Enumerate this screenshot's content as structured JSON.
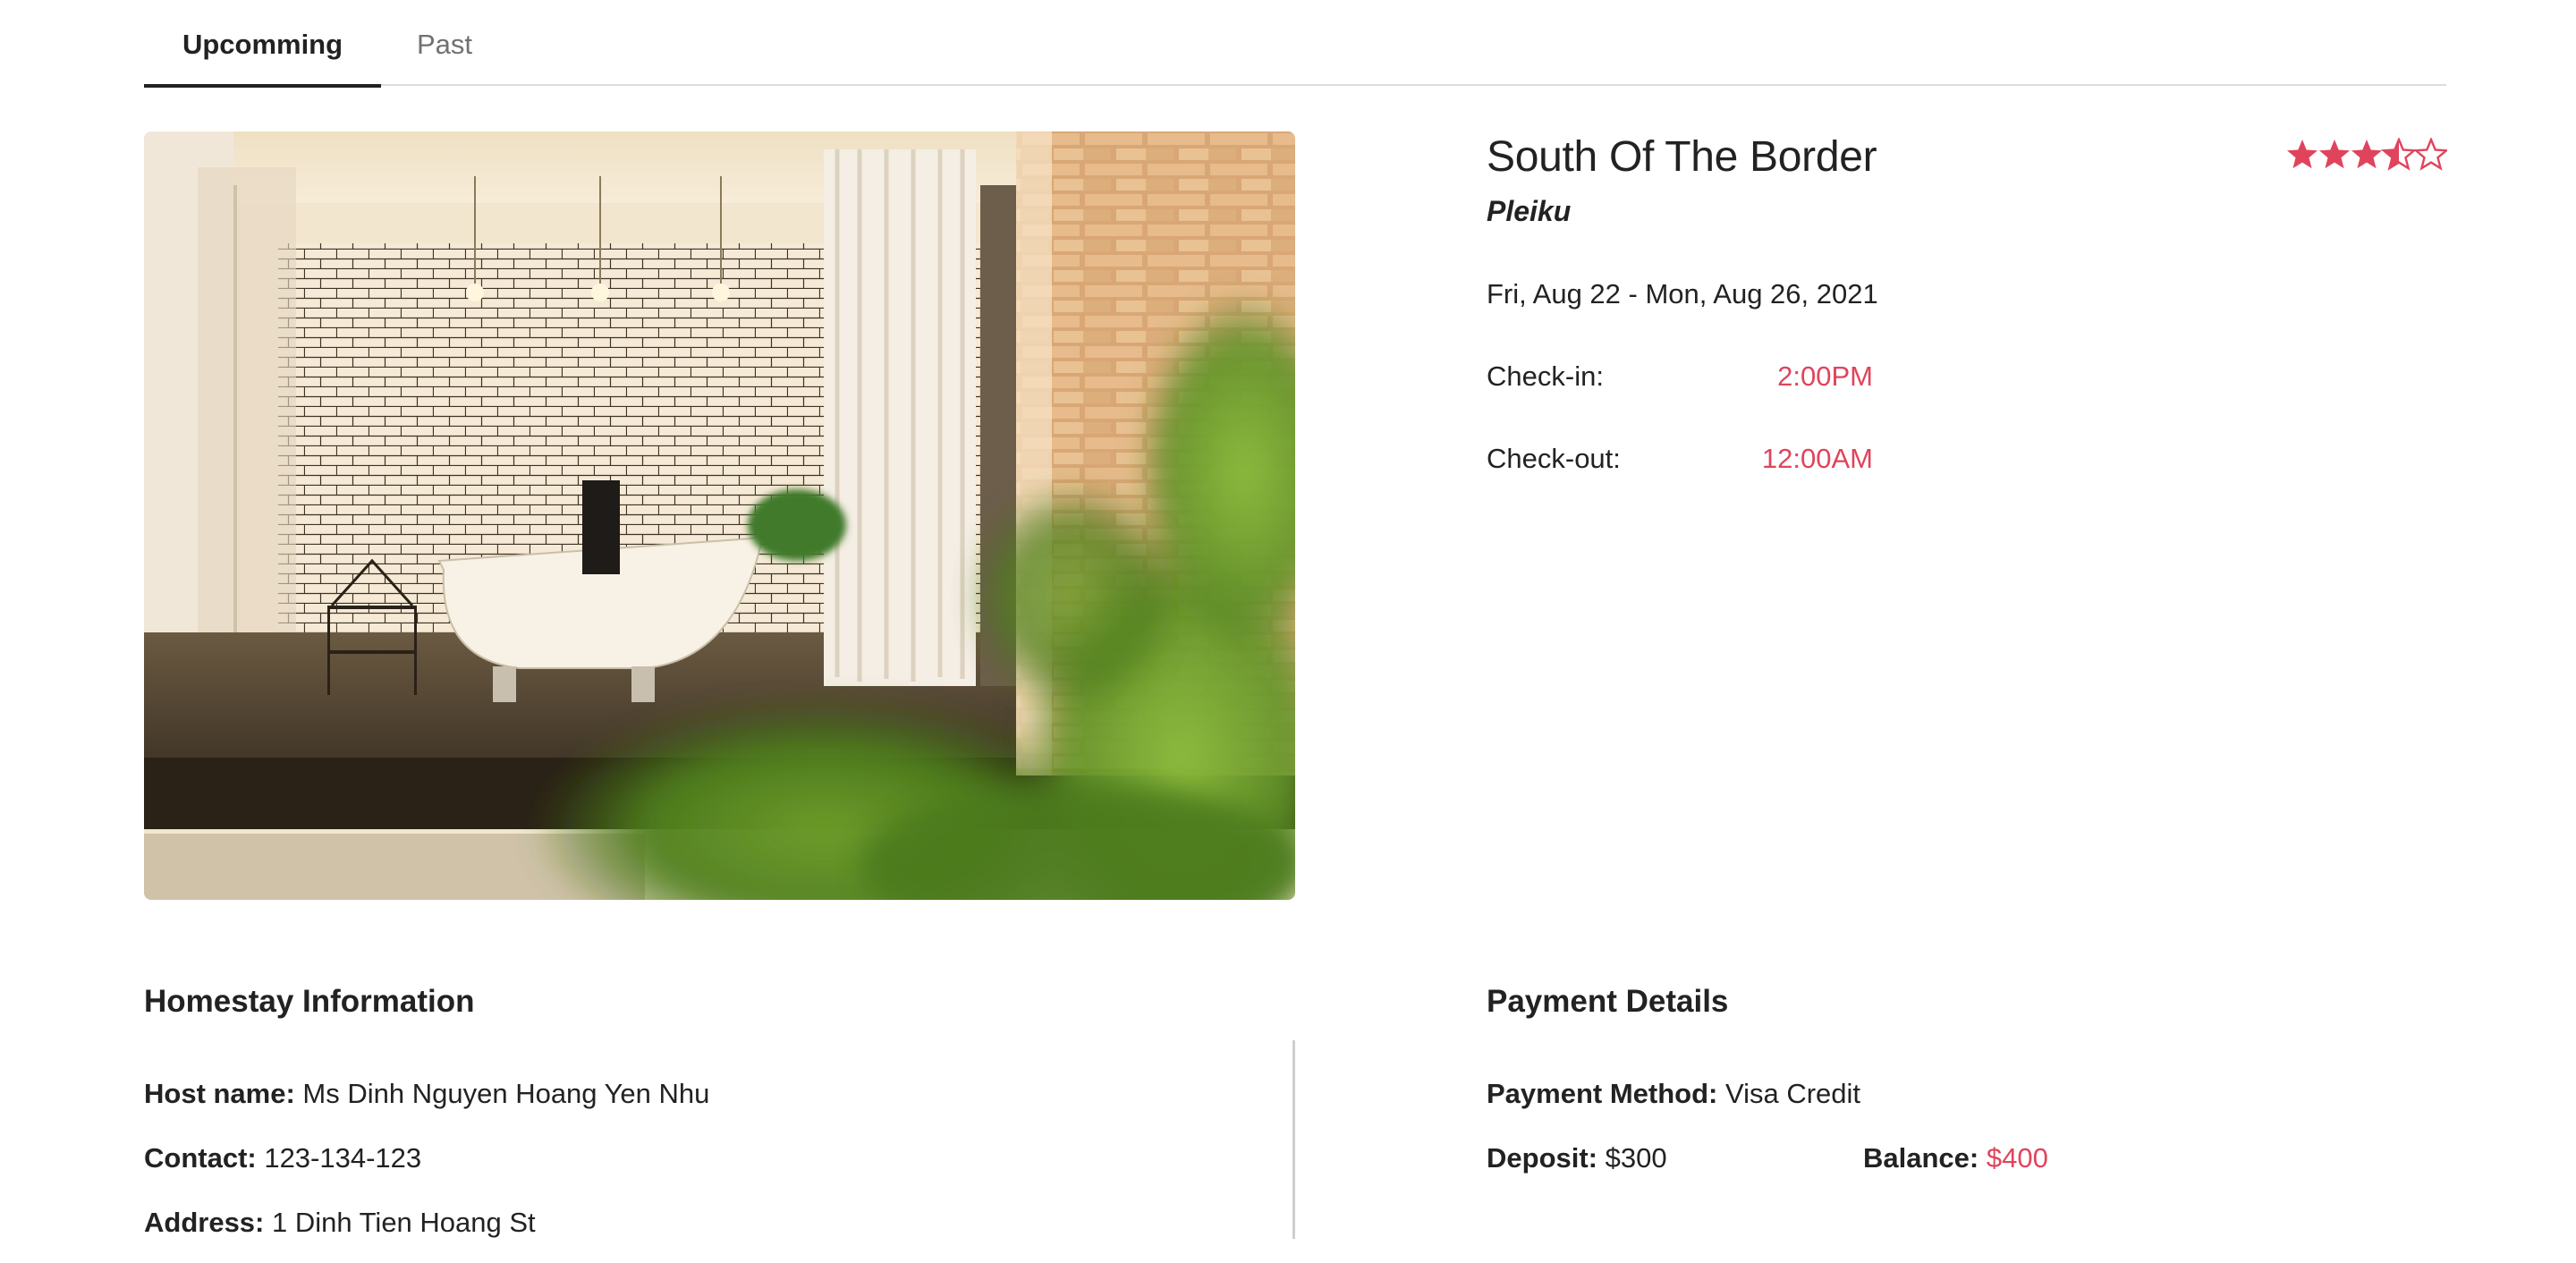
{
  "tabs": [
    {
      "label": "Upcomming",
      "active": true
    },
    {
      "label": "Past",
      "active": false
    }
  ],
  "photo": {
    "description_icon": "bathroom-photo"
  },
  "listing": {
    "title": "South Of The Border",
    "city": "Pleiku",
    "rating": 3.5,
    "rating_max": 5,
    "dates": "Fri, Aug 22 - Mon, Aug 26, 2021",
    "checkin_label": "Check-in:",
    "checkin_value": "2:00PM",
    "checkout_label": "Check-out:",
    "checkout_value": "12:00AM"
  },
  "homestay": {
    "heading": "Homestay Information",
    "host_label": "Host name:",
    "host_value": "Ms Dinh Nguyen Hoang Yen Nhu",
    "contact_label": "Contact:",
    "contact_value": "123-134-123",
    "address_label": "Address:",
    "address_value": "1 Dinh Tien Hoang St"
  },
  "payment": {
    "heading": "Payment Details",
    "method_label": "Payment Method:",
    "method_value": "Visa Credit",
    "deposit_label": "Deposit:",
    "deposit_value": "$300",
    "balance_label": "Balance:",
    "balance_value": "$400"
  },
  "colors": {
    "accent": "#e0445c",
    "text": "#222222",
    "muted": "#717171"
  }
}
